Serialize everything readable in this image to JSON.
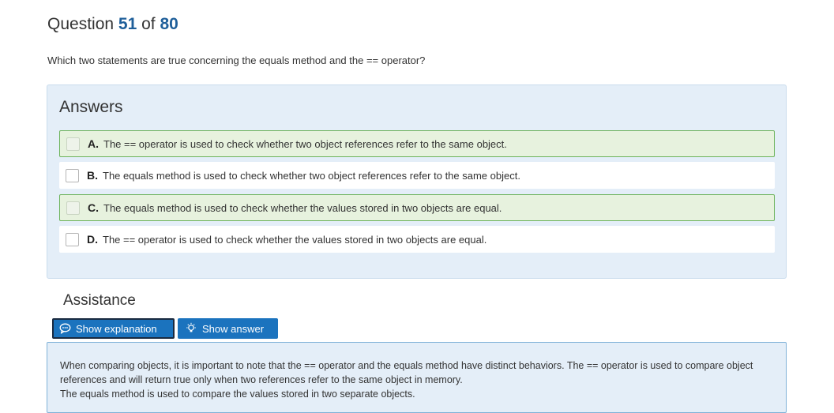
{
  "question": {
    "prefix": "Question",
    "number": "51",
    "of_label": "of",
    "total": "80",
    "text": "Which two statements are true concerning the equals method and the == operator?"
  },
  "answers": {
    "title": "Answers",
    "items": [
      {
        "letter": "A.",
        "text": "The == operator is used to check whether two object references refer to the same object.",
        "correct": true
      },
      {
        "letter": "B.",
        "text": "The equals method is used to check whether two object references refer to the same object.",
        "correct": false
      },
      {
        "letter": "C.",
        "text": "The equals method is used to check whether the values stored in two objects are equal.",
        "correct": true
      },
      {
        "letter": "D.",
        "text": "The == operator is used to check whether the values stored in two objects are equal.",
        "correct": false
      }
    ]
  },
  "assistance": {
    "title": "Assistance",
    "show_explanation_label": "Show explanation",
    "show_answer_label": "Show answer",
    "explanation_line1": "When comparing objects, it is important to note that the == operator and the equals method have distinct behaviors. The == operator is used to compare object references and will return true only when two references refer to the same object in memory.",
    "explanation_line2": "The equals method is used to compare the values stored in two separate objects."
  },
  "colors": {
    "accent": "#1b73be",
    "question_number": "#1f5f9a",
    "correct_border": "#6db35c",
    "correct_bg": "#e7f2de",
    "panel_bg": "#e4eef8"
  },
  "icons": {
    "explanation": "speech-bubble-icon",
    "answer": "lightbulb-icon"
  }
}
